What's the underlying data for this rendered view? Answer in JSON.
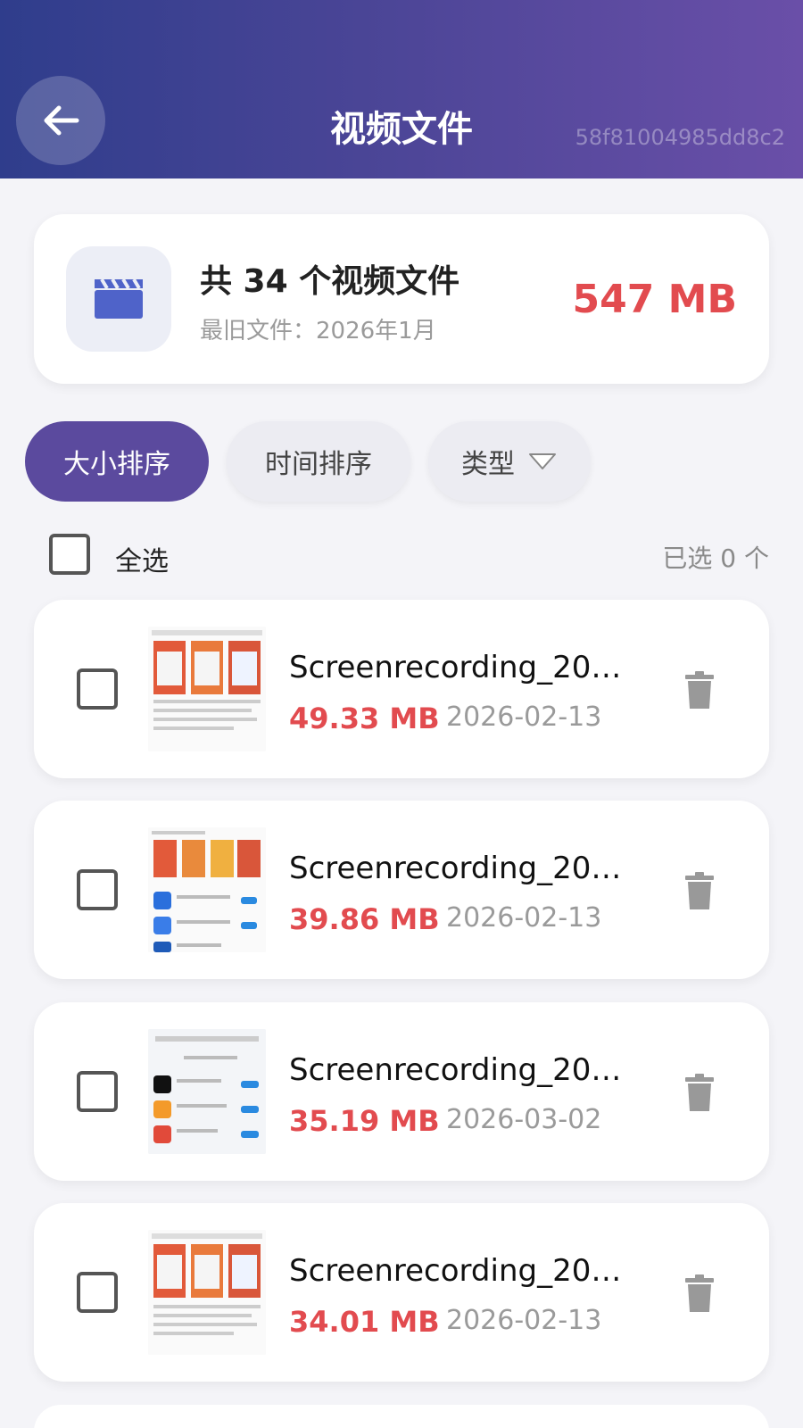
{
  "header": {
    "title": "视频文件",
    "id_text": "58f81004985dd8c2"
  },
  "summary": {
    "count_text": "共 34 个视频文件",
    "oldest_text": "最旧文件：2026年1月",
    "total_size": "547 MB",
    "icon": "film-clapper-icon"
  },
  "filters": {
    "size_sort": "大小排序",
    "time_sort": "时间排序",
    "type": "类型"
  },
  "selection": {
    "select_all": "全选",
    "selected_count": "已选 0 个"
  },
  "files": [
    {
      "name": "Screenrecording_20…",
      "size": "49.33 MB",
      "date": "2026-02-13"
    },
    {
      "name": "Screenrecording_20…",
      "size": "39.86 MB",
      "date": "2026-02-13"
    },
    {
      "name": "Screenrecording_20…",
      "size": "35.19 MB",
      "date": "2026-03-02"
    },
    {
      "name": "Screenrecording_20…",
      "size": "34.01 MB",
      "date": "2026-02-13"
    }
  ],
  "colors": {
    "accent": "#5b4a9e",
    "size_red": "#e24b4f",
    "header_start": "#2f3d8c",
    "header_end": "#6a4fa8"
  }
}
